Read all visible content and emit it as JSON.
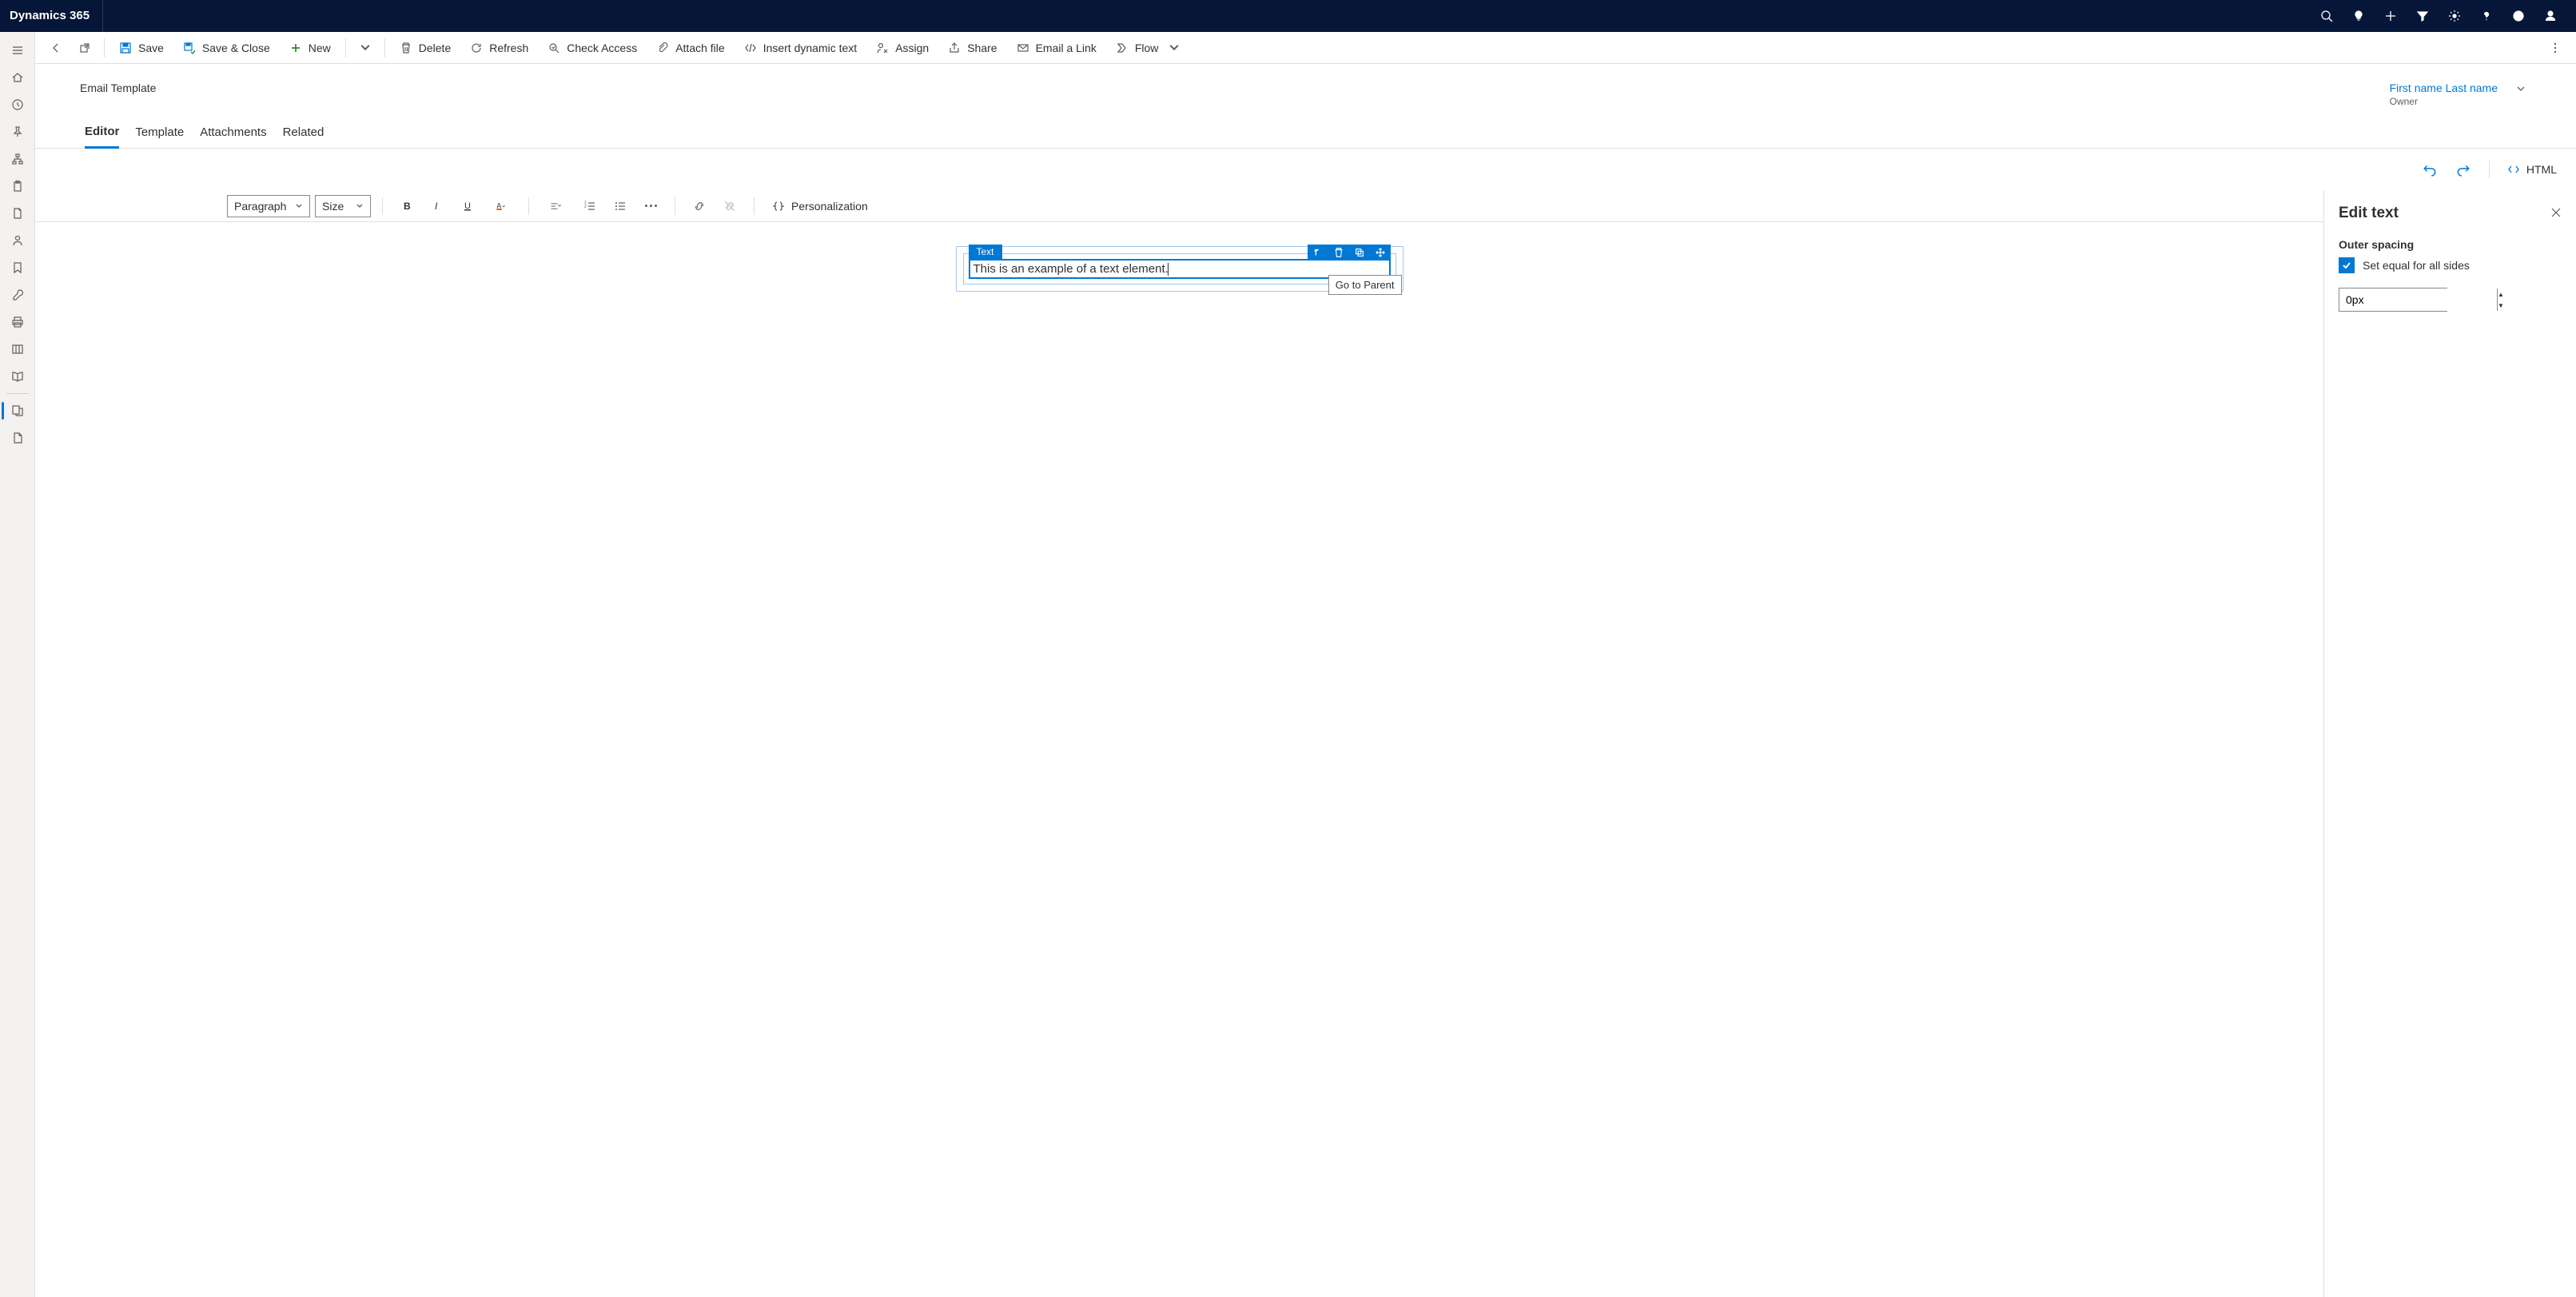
{
  "brand": "Dynamics 365",
  "commands": {
    "save": "Save",
    "save_close": "Save & Close",
    "new": "New",
    "delete": "Delete",
    "refresh": "Refresh",
    "check_access": "Check Access",
    "attach_file": "Attach file",
    "insert_dynamic": "Insert dynamic text",
    "assign": "Assign",
    "share": "Share",
    "email_link": "Email a Link",
    "flow": "Flow"
  },
  "header": {
    "subtitle": "Email Template",
    "owner_name": "First name Last name",
    "owner_label": "Owner"
  },
  "tabs": {
    "editor": "Editor",
    "template": "Template",
    "attachments": "Attachments",
    "related": "Related"
  },
  "editor_actions": {
    "html": "HTML"
  },
  "format": {
    "paragraph": "Paragraph",
    "size": "Size",
    "personalization": "Personalization"
  },
  "canvas": {
    "element_label": "Text",
    "text_content": "This is an example of a text element.",
    "tooltip": "Go to Parent"
  },
  "panel": {
    "title": "Edit text",
    "outer_spacing": "Outer spacing",
    "set_equal": "Set equal for all sides",
    "spacing_value": "0px"
  }
}
